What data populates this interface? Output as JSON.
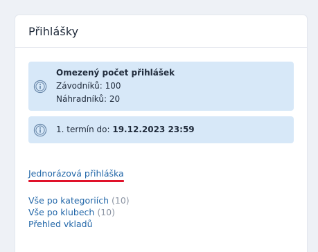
{
  "panel": {
    "title": "Přihlášky"
  },
  "limit_box": {
    "heading": "Omezený počet přihlášek",
    "competitors_label": "Závodníků:",
    "competitors_value": "100",
    "substitutes_label": "Náhradníků:",
    "substitutes_value": "20",
    "icon": "info-circle-icon"
  },
  "deadline_box": {
    "label": "1. termín do:",
    "value": "19.12.2023 23:59",
    "icon": "info-circle-icon"
  },
  "links": {
    "one_time_entry": "Jednorázová přihláška",
    "by_category_label": "Vše po kategoriích",
    "by_category_count": "(10)",
    "by_club_label": "Vše po klubech",
    "by_club_count": "(10)",
    "deposits_overview": "Přehled vkladů"
  },
  "colors": {
    "info_bg": "#d7e8f8",
    "link": "#2166a8",
    "highlight_underline": "#e0122a"
  }
}
